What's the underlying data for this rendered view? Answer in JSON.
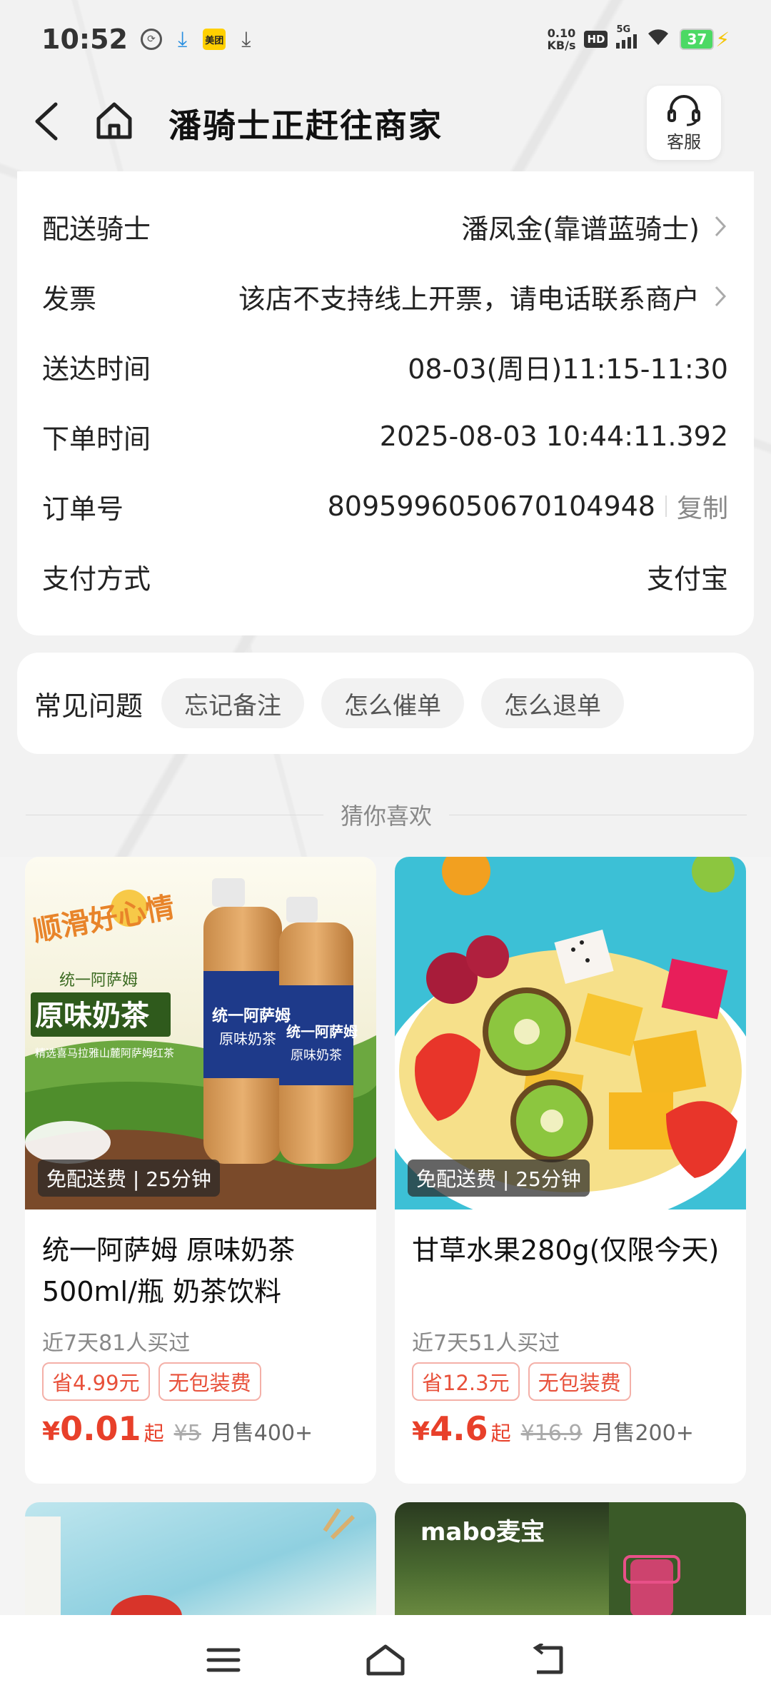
{
  "status_bar": {
    "time": "10:52",
    "meituan_badge": "美团",
    "net_speed_value": "0.10",
    "net_speed_unit": "KB/s",
    "hd": "HD",
    "signal_type": "5G",
    "battery": "37",
    "icons": [
      "sync-icon",
      "download-icon",
      "meituan-app-icon",
      "download-icon",
      "hd-icon",
      "signal-icon",
      "wifi-icon",
      "battery-icon",
      "charging-icon"
    ]
  },
  "header": {
    "title": "潘骑士正赶往商家",
    "service_label": "客服"
  },
  "order_info": {
    "rider_label": "配送骑士",
    "rider_value": "潘凤金(靠谱蓝骑士)",
    "invoice_label": "发票",
    "invoice_value": "该店不支持线上开票，请电话联系商户",
    "delivery_time_label": "送达时间",
    "delivery_time_value": "08-03(周日)11:15-11:30",
    "order_time_label": "下单时间",
    "order_time_value": "2025-08-03 10:44:11.392",
    "order_no_label": "订单号",
    "order_no_value": "8095996050670104948",
    "copy_label": "复制",
    "payment_label": "支付方式",
    "payment_value": "支付宝"
  },
  "faq": {
    "title": "常见问题",
    "chips": [
      "忘记备注",
      "怎么催单",
      "怎么退单"
    ]
  },
  "recommend": {
    "title": "猜你喜欢",
    "products": [
      {
        "delivery_tag": "免配送费 | 25分钟",
        "name": "统一阿萨姆 原味奶茶500ml/瓶 奶茶饮料",
        "sold_recent": "近7天81人买过",
        "tag1": "省4.99元",
        "tag2": "无包装费",
        "price_symbol": "¥",
        "price": "0.01",
        "price_suffix": "起",
        "old_price": "¥5",
        "monthly_sales": "月售400+",
        "img_text_1": "顺滑好心情",
        "img_text_2": "统一阿萨姆",
        "img_text_3": "原味奶茶",
        "img_text_4": "精选喜马拉雅山麓阿萨姆红茶",
        "bottle_label_1": "统一阿萨姆",
        "bottle_label_2": "原味奶茶"
      },
      {
        "delivery_tag": "免配送费 | 25分钟",
        "name": "甘草水果280g(仅限今天)",
        "sold_recent": "近7天51人买过",
        "tag1": "省12.3元",
        "tag2": "无包装费",
        "price_symbol": "¥",
        "price": "4.6",
        "price_suffix": "起",
        "old_price": "¥16.9",
        "monthly_sales": "月售200+"
      }
    ],
    "partial_brand": "mabo麦宝"
  },
  "colors": {
    "accent_red": "#e8402a",
    "tag_border": "#f4b0a8",
    "background": "#f4f4f4",
    "card": "#ffffff"
  }
}
